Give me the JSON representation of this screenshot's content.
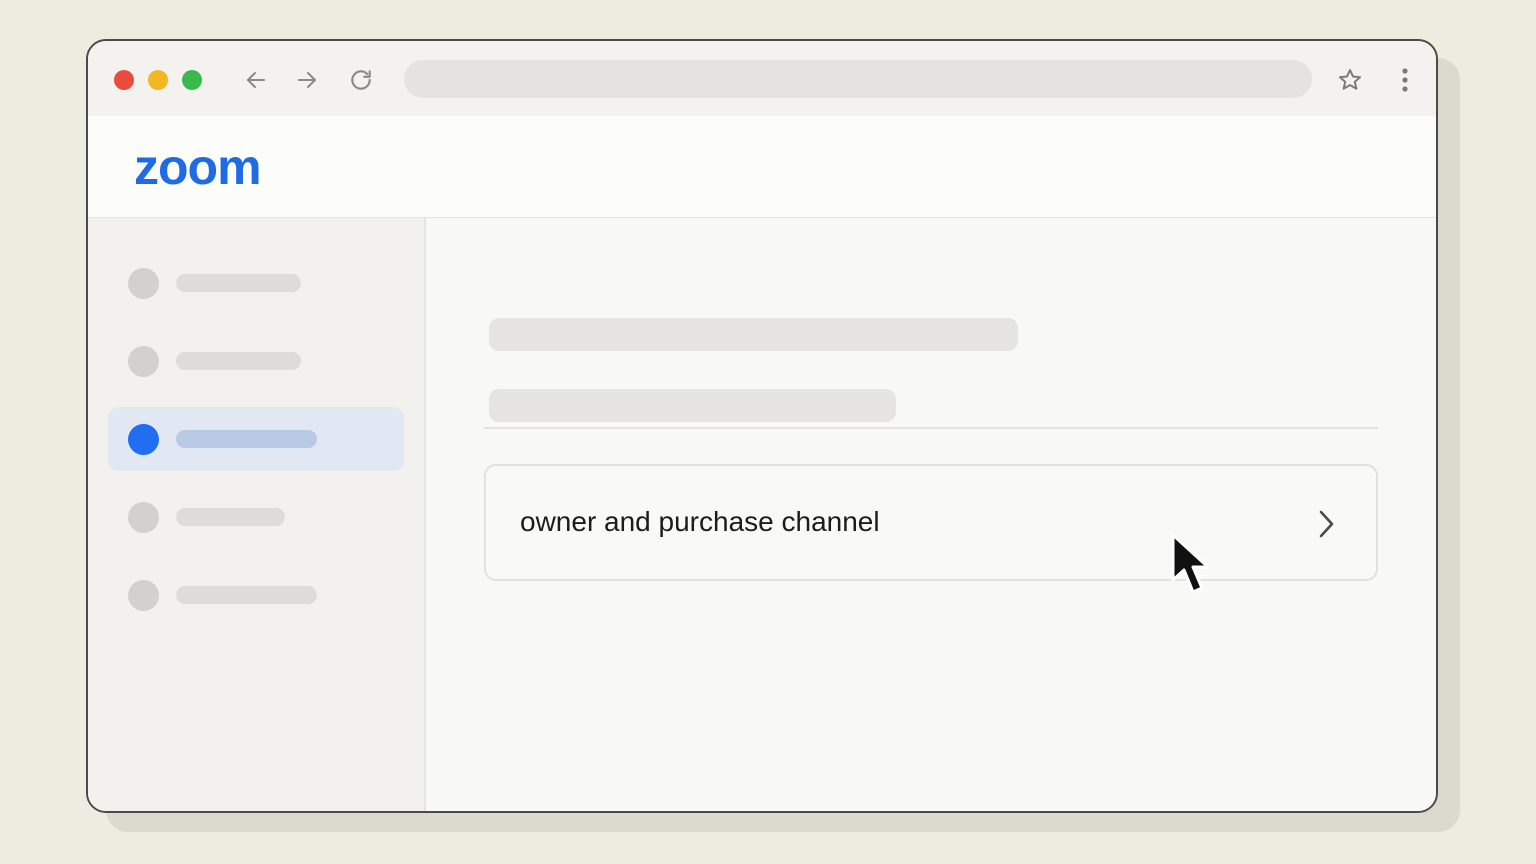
{
  "browser": {
    "back_icon": "arrow-left-icon",
    "forward_icon": "arrow-right-icon",
    "reload_icon": "reload-icon",
    "bookmark_icon": "star-icon",
    "menu_icon": "kebab-menu-icon",
    "traffic_lights": {
      "close": "#e94c3f",
      "minimize": "#f3b723",
      "maximize": "#3ab94c"
    }
  },
  "app": {
    "logo_text": "zoom",
    "brand_color": "#1f6be6"
  },
  "settings_row": {
    "label": "owner and purchase channel",
    "chevron_icon": "chevron-right-icon"
  },
  "accent_color": "#1f6ff0"
}
